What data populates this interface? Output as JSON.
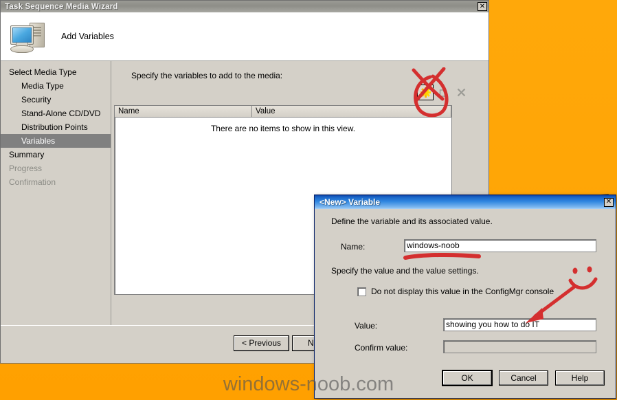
{
  "wizard": {
    "title": "Task Sequence Media Wizard",
    "close_label": "✕",
    "header_title": "Add Variables",
    "icon": "computer-icon",
    "sidebar": [
      {
        "label": "Select Media Type",
        "level": 0,
        "state": "normal"
      },
      {
        "label": "Media Type",
        "level": 1,
        "state": "normal"
      },
      {
        "label": "Security",
        "level": 1,
        "state": "normal"
      },
      {
        "label": "Stand-Alone CD/DVD",
        "level": 1,
        "state": "normal"
      },
      {
        "label": "Distribution Points",
        "level": 1,
        "state": "normal"
      },
      {
        "label": "Variables",
        "level": 1,
        "state": "selected"
      },
      {
        "label": "Summary",
        "level": 0,
        "state": "normal"
      },
      {
        "label": "Progress",
        "level": 0,
        "state": "disabled"
      },
      {
        "label": "Confirmation",
        "level": 0,
        "state": "disabled"
      }
    ],
    "instruction": "Specify the variables to add to the media:",
    "toolbar": [
      {
        "name": "new-variable-button",
        "icon": "star-new-icon",
        "enabled": true
      },
      {
        "name": "edit-variable-button",
        "icon": "edit-icon",
        "enabled": false
      },
      {
        "name": "delete-variable-button",
        "icon": "delete-x-icon",
        "enabled": false
      }
    ],
    "listview": {
      "columns": [
        "Name",
        "Value"
      ],
      "rows": [],
      "empty_text": "There are no items to show in this view."
    },
    "buttons": {
      "previous": "< Previous",
      "next": "Next >"
    }
  },
  "dialog": {
    "title": "<New> Variable",
    "close_label": "✕",
    "intro": "Define the variable and its associated value.",
    "name_label": "Name:",
    "name_value": "windows-noob",
    "sub_instruction": "Specify the value and the value settings.",
    "checkbox_label": "Do not display this value in the ConfigMgr console",
    "checkbox_checked": false,
    "value_label": "Value:",
    "value_value": "showing you how to do IT",
    "confirm_label": "Confirm value:",
    "confirm_value": "",
    "confirm_enabled": false,
    "buttons": {
      "ok": "OK",
      "cancel": "Cancel",
      "help": "Help"
    }
  },
  "annotations": {
    "color": "#d42f2f",
    "marks": [
      {
        "name": "red-x-mark",
        "target": "new-variable-button"
      },
      {
        "name": "red-circle-mark",
        "target": "new-variable-button"
      },
      {
        "name": "red-underline-mark",
        "target": "name-field"
      },
      {
        "name": "red-arrow-mark",
        "target": "value-field"
      },
      {
        "name": "red-smiley-mark",
        "target": "none"
      }
    ]
  },
  "desktop": {
    "wallpaper_color": "#FFA505",
    "watermark": "windows-noob.com"
  }
}
